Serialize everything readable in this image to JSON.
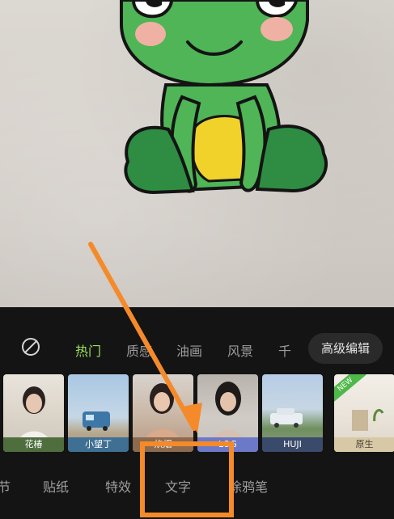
{
  "colors": {
    "accent": "#9be35c",
    "annotation": "#f58a2a",
    "panel_bg": "#141414"
  },
  "photo": {
    "subject_icon": "frog-drawing"
  },
  "categories": {
    "none_icon": "no-filter-icon",
    "items": [
      {
        "label": "热门",
        "active": true
      },
      {
        "label": "质感",
        "active": false
      },
      {
        "label": "油画",
        "active": false
      },
      {
        "label": "风景",
        "active": false
      },
      {
        "label": "千",
        "active": false
      }
    ],
    "advanced_label": "高级编辑"
  },
  "filters": [
    {
      "label": "花椿"
    },
    {
      "label": "小望丁"
    },
    {
      "label": "炊烟"
    },
    {
      "label": "LOG"
    },
    {
      "label": "HUJI"
    },
    {
      "label": "原生",
      "badge": "NEW"
    }
  ],
  "tools": [
    {
      "label": "节"
    },
    {
      "label": "贴纸"
    },
    {
      "label": "特效"
    },
    {
      "label": "文字"
    },
    {
      "label": "涂鸦笔"
    }
  ],
  "annotation": {
    "highlight_target": "文字",
    "arrow_icon": "annotation-arrow"
  }
}
